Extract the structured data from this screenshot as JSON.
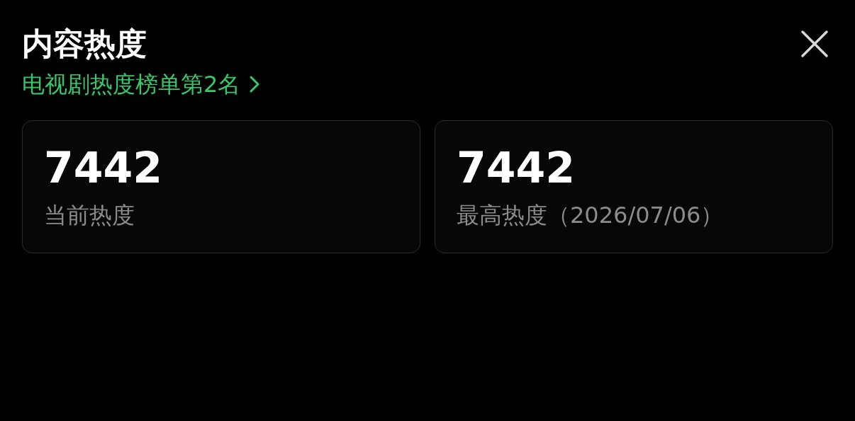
{
  "header": {
    "title": "内容热度",
    "ranking_link": "电视剧热度榜单第2名"
  },
  "stats": [
    {
      "value": "7442",
      "label": "当前热度"
    },
    {
      "value": "7442",
      "label": "最高热度（2026/07/06）"
    }
  ]
}
